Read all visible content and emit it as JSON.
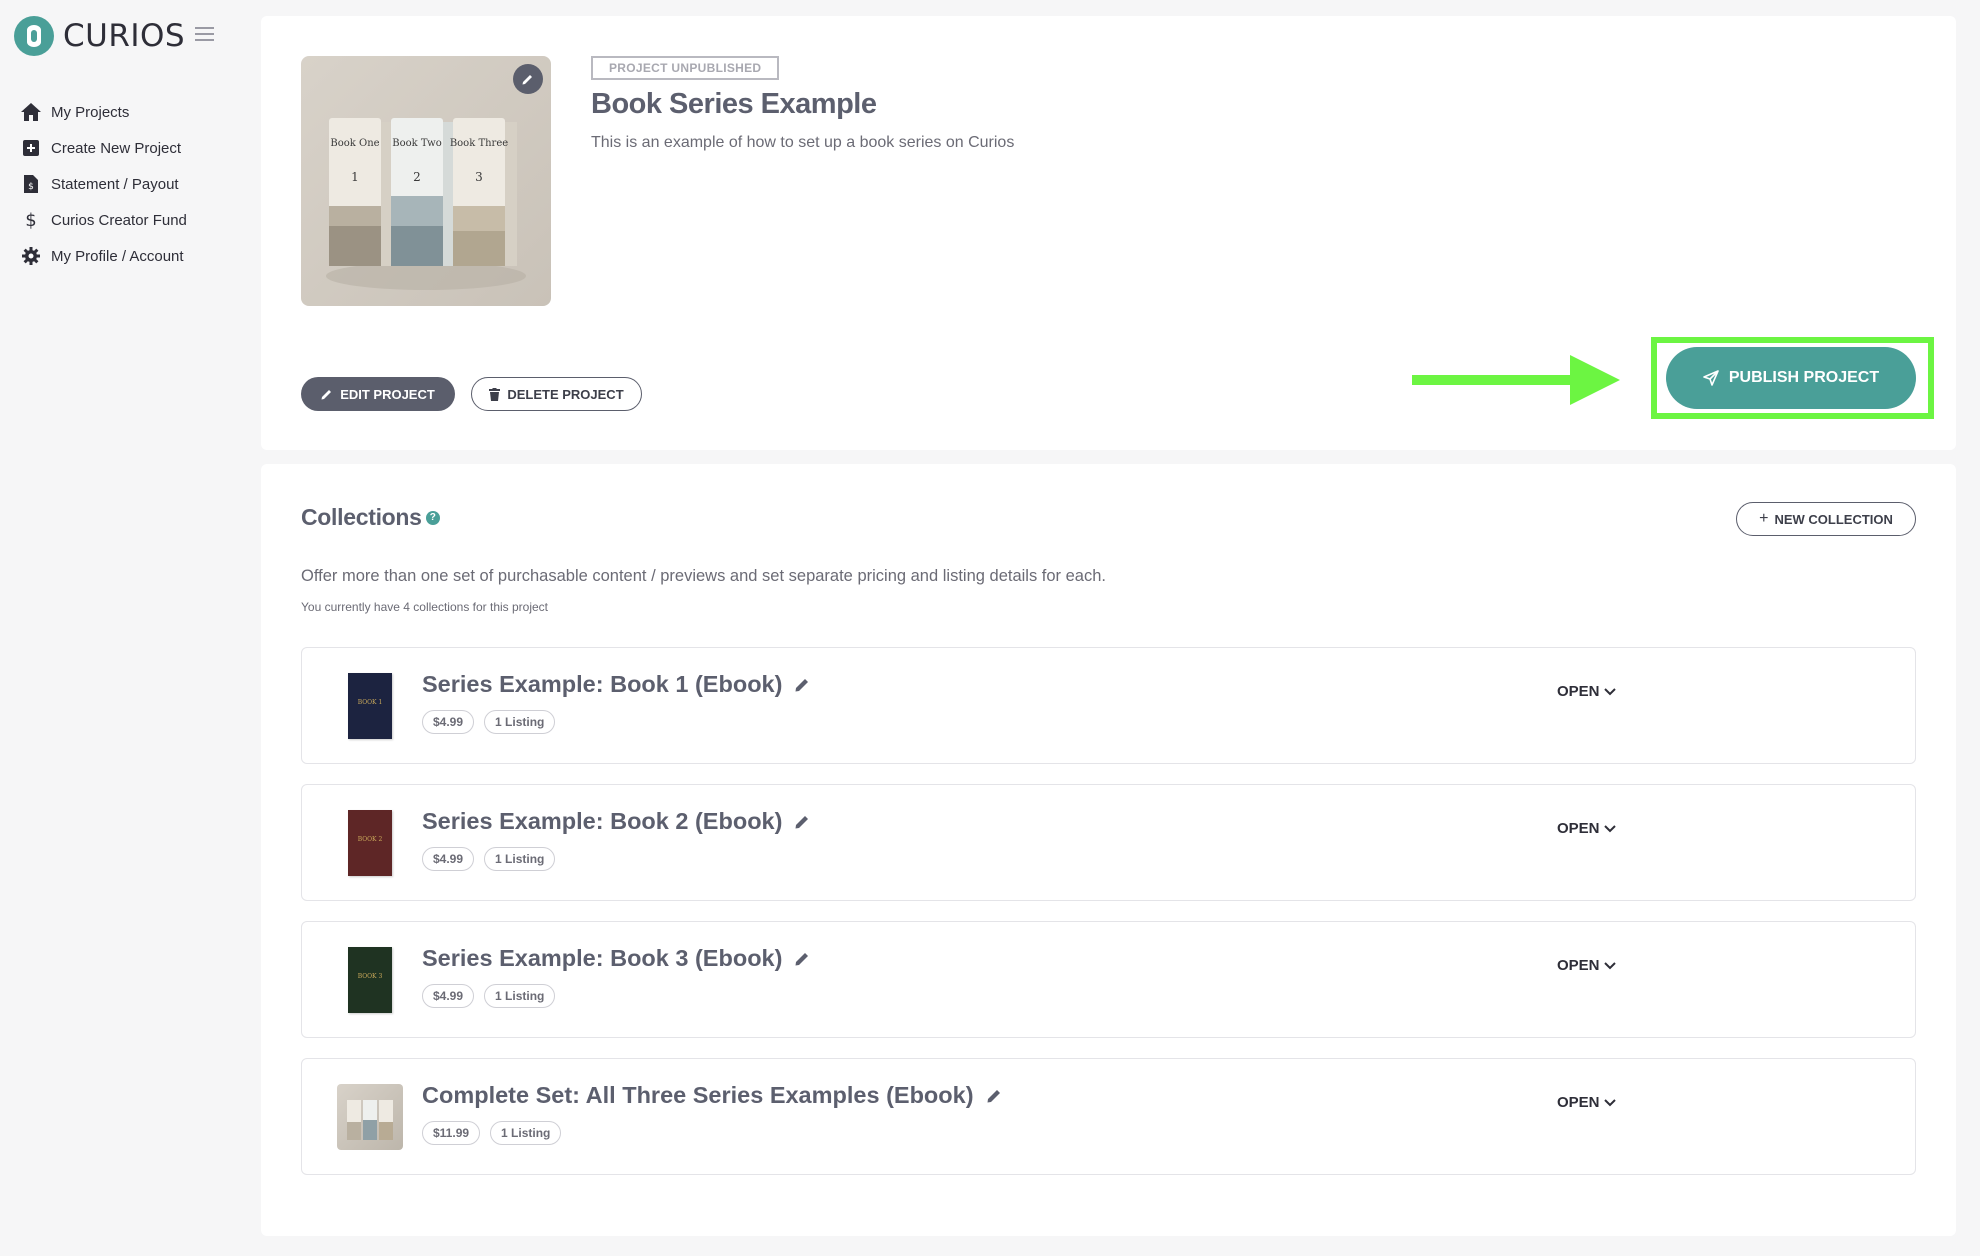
{
  "app": {
    "name": "CURIOS"
  },
  "sidebar": {
    "items": [
      {
        "label": "My Projects",
        "icon": "home-icon"
      },
      {
        "label": "Create New Project",
        "icon": "plus-square-icon"
      },
      {
        "label": "Statement / Payout",
        "icon": "invoice-icon"
      },
      {
        "label": "Curios Creator Fund",
        "icon": "dollar-icon"
      },
      {
        "label": "My Profile / Account",
        "icon": "gear-icon"
      }
    ]
  },
  "project": {
    "status": "PROJECT UNPUBLISHED",
    "title": "Book Series Example",
    "description": "This is an example of how to set up a book series on Curios",
    "cover_books": [
      "Book One",
      "Book Two",
      "Book Three"
    ],
    "cover_numbers": [
      "1",
      "2",
      "3"
    ],
    "edit_label": "EDIT PROJECT",
    "delete_label": "DELETE PROJECT",
    "publish_label": "PUBLISH PROJECT"
  },
  "collections": {
    "title": "Collections",
    "new_label": "NEW COLLECTION",
    "description": "Offer more than one set of purchasable content / previews and set separate pricing and listing details for each.",
    "count_text": "You currently have 4 collections for this project",
    "open_label": "OPEN",
    "items": [
      {
        "title": "Series Example: Book 1 (Ebook)",
        "price": "$4.99",
        "listings": "1 Listing",
        "thumb_color": "#1c2340",
        "thumb_text": "BOOK 1"
      },
      {
        "title": "Series Example: Book 2 (Ebook)",
        "price": "$4.99",
        "listings": "1 Listing",
        "thumb_color": "#5e2626",
        "thumb_text": "BOOK 2"
      },
      {
        "title": "Series Example: Book 3 (Ebook)",
        "price": "$4.99",
        "listings": "1 Listing",
        "thumb_color": "#1f3322",
        "thumb_text": "BOOK 3"
      },
      {
        "title": "Complete Set: All Three Series Examples (Ebook)",
        "price": "$11.99",
        "listings": "1 Listing",
        "thumb_color": "#cfc8be",
        "thumb_text": ""
      }
    ]
  },
  "colors": {
    "accent": "#4a9f98",
    "highlight": "#6cf542",
    "dark_button": "#5b5e6c"
  }
}
